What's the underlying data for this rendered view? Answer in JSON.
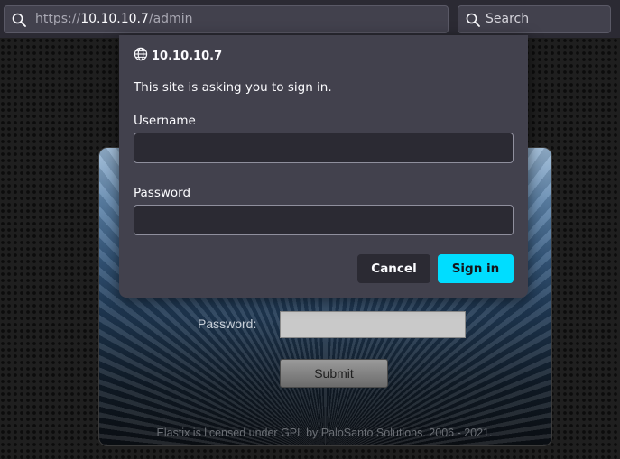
{
  "browser": {
    "url_scheme": "https://",
    "url_host": "10.10.10.7",
    "url_path": "/admin",
    "search_placeholder": "Search"
  },
  "page": {
    "password_label": "Password:",
    "submit_label": "Submit",
    "footer": "Elastix is licensed under GPL by PaloSanto Solutions. 2006 - 2021."
  },
  "auth_dialog": {
    "origin": "10.10.10.7",
    "message": "This site is asking you to sign in.",
    "username_label": "Username",
    "username_value": "",
    "password_label": "Password",
    "password_value": "",
    "cancel_label": "Cancel",
    "signin_label": "Sign in"
  },
  "colors": {
    "accent": "#00ddff",
    "dialog_bg": "#42414d",
    "toolbar_bg": "#2b2a33"
  },
  "icons": [
    "search-icon",
    "globe-icon"
  ]
}
